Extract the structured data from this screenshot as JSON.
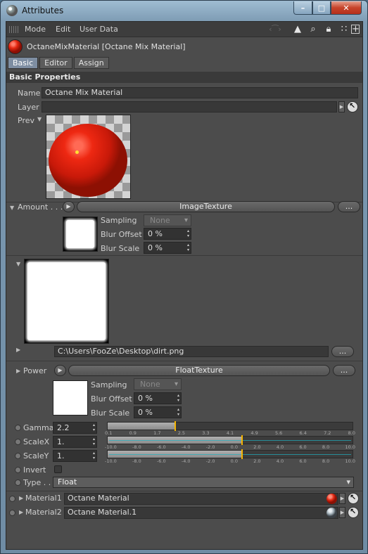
{
  "window": {
    "title": "Attributes",
    "min_label": "–",
    "max_label": "□",
    "close_label": "✕"
  },
  "menubar": {
    "items": [
      "Mode",
      "Edit",
      "User Data"
    ],
    "icons": [
      "arrow-cursor-icon",
      "search-icon",
      "lock-icon",
      "hierarchy-icon",
      "new-panel-icon"
    ]
  },
  "object": {
    "name": "OctaneMixMaterial [Octane Mix Material]"
  },
  "tabs": [
    "Basic",
    "Editor",
    "Assign"
  ],
  "section_title": "Basic Properties",
  "name_field": {
    "label": "Name",
    "value": "Octane Mix Material"
  },
  "layer_field": {
    "label": "Layer",
    "value": ""
  },
  "prev_label": "Prev",
  "amount": {
    "label": "Amount . . .",
    "texture_button": "ImageTexture",
    "more_button": "...",
    "sampling_label": "Sampling",
    "sampling_value": "None",
    "blur_offset_label": "Blur Offset",
    "blur_offset_value": "0 %",
    "blur_scale_label": "Blur Scale",
    "blur_scale_value": "0 %"
  },
  "image": {
    "path": "C:\\Users\\FooZe\\Desktop\\dirt.png",
    "more_button": "..."
  },
  "power": {
    "label": "Power",
    "texture_button": "FloatTexture",
    "more_button": "...",
    "sampling_label": "Sampling",
    "sampling_value": "None",
    "blur_offset_label": "Blur Offset",
    "blur_offset_value": "0 %",
    "blur_scale_label": "Blur Scale",
    "blur_scale_value": "0 %"
  },
  "gamma": {
    "label": "Gamma",
    "value": "2.2",
    "slider_fraction": 0.275,
    "scale": [
      "0.1",
      "0.9",
      "1.7",
      "2.5",
      "3.3",
      "4.1",
      "4.9",
      "5.6",
      "6.4",
      "7.2",
      "8.0"
    ]
  },
  "scalex": {
    "label": "ScaleX",
    "value": "1.",
    "slider_fraction": 0.55,
    "scale": [
      "-10.0",
      "-8.0",
      "-6.0",
      "-4.0",
      "-2.0",
      "0.0",
      "2.0",
      "4.0",
      "6.0",
      "8.0",
      "10.0"
    ]
  },
  "scaley": {
    "label": "ScaleY",
    "value": "1.",
    "slider_fraction": 0.55,
    "scale": [
      "-10.0",
      "-8.0",
      "-6.0",
      "-4.0",
      "-2.0",
      "0.0",
      "2.0",
      "4.0",
      "6.0",
      "8.0",
      "10.0"
    ]
  },
  "invert": {
    "label": "Invert",
    "checked": false
  },
  "type": {
    "label": "Type . .",
    "value": "Float"
  },
  "material1": {
    "label": "Material1",
    "value": "Octane Material"
  },
  "material2": {
    "label": "Material2",
    "value": "Octane Material.1"
  }
}
